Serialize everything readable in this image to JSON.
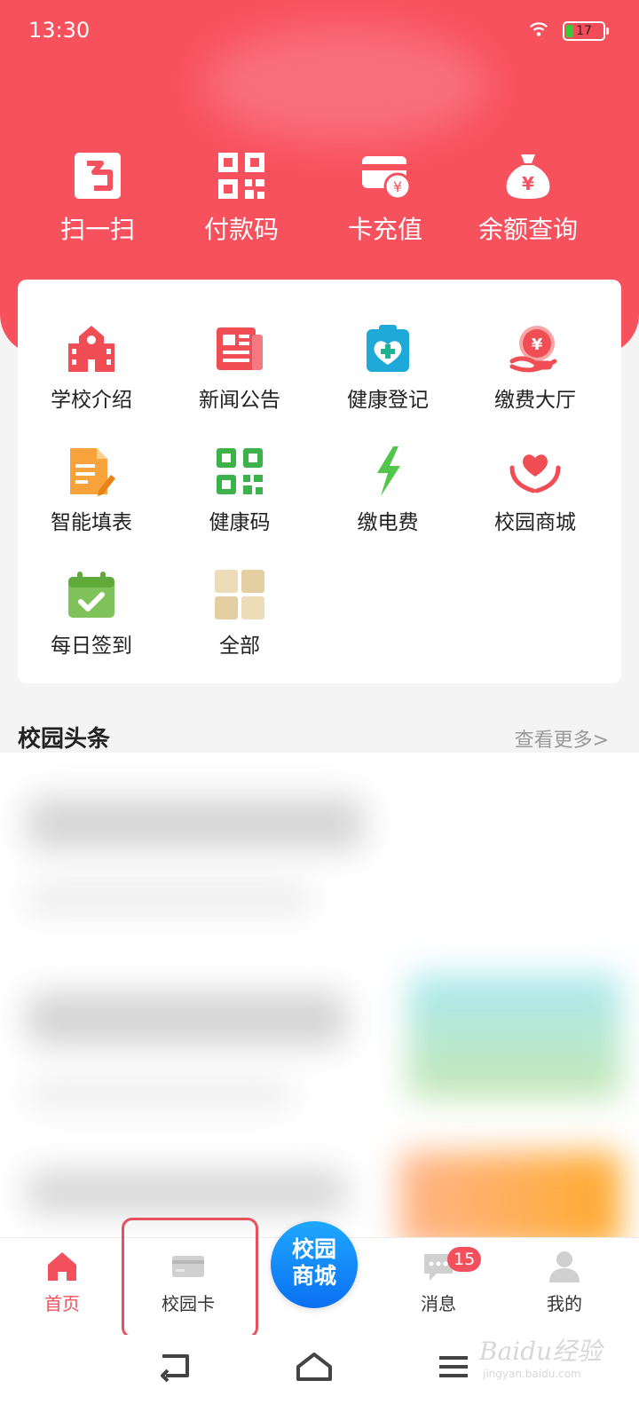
{
  "status_bar": {
    "time": "13:30",
    "battery": "17"
  },
  "quick_actions": [
    {
      "label": "扫一扫",
      "icon": "scan-icon"
    },
    {
      "label": "付款码",
      "icon": "qr-code-icon"
    },
    {
      "label": "卡充值",
      "icon": "card-recharge-icon"
    },
    {
      "label": "余额查询",
      "icon": "money-bag-icon"
    }
  ],
  "services": [
    {
      "label": "学校介绍",
      "icon": "school-icon"
    },
    {
      "label": "新闻公告",
      "icon": "newspaper-icon"
    },
    {
      "label": "健康登记",
      "icon": "health-kit-icon"
    },
    {
      "label": "缴费大厅",
      "icon": "payment-hall-icon"
    },
    {
      "label": "智能填表",
      "icon": "form-pencil-icon"
    },
    {
      "label": "健康码",
      "icon": "health-code-icon"
    },
    {
      "label": "缴电费",
      "icon": "lightning-icon"
    },
    {
      "label": "校园商城",
      "icon": "heart-hands-icon"
    },
    {
      "label": "每日签到",
      "icon": "calendar-check-icon"
    },
    {
      "label": "全部",
      "icon": "grid-all-icon"
    }
  ],
  "news": {
    "title": "校园头条",
    "more": "查看更多>"
  },
  "tabbar": {
    "tabs": [
      {
        "label": "首页",
        "icon": "home-icon",
        "active": true
      },
      {
        "label": "校园卡",
        "icon": "card-icon",
        "active": false
      },
      {
        "label": "消息",
        "icon": "message-icon",
        "active": false,
        "badge": "15"
      },
      {
        "label": "我的",
        "icon": "user-icon",
        "active": false
      }
    ],
    "center": {
      "line1": "校园",
      "line2": "商城"
    }
  },
  "system_nav": {
    "icons": [
      "back-icon",
      "home-outline-icon",
      "menu-icon"
    ]
  },
  "watermark": {
    "brand": "Baidu经验",
    "url": "jingyan.baidu.com"
  },
  "colors": {
    "brand_red": "#f8515e",
    "accent_blue": "#0a6ff2",
    "active_tab": "#f2505c"
  }
}
